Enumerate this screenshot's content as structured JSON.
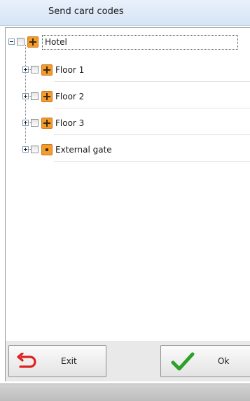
{
  "window": {
    "title": "Send card codes"
  },
  "tree": {
    "root": {
      "label": "Hotel",
      "icon": "floor-grid-icon"
    },
    "children": [
      {
        "label": "Floor 1",
        "icon": "floor-grid-icon"
      },
      {
        "label": "Floor 2",
        "icon": "floor-grid-icon"
      },
      {
        "label": "Floor 3",
        "icon": "floor-grid-icon"
      },
      {
        "label": "External gate",
        "icon": "gate-icon"
      }
    ]
  },
  "buttons": {
    "exit_label": "Exit",
    "ok_label": "Ok"
  },
  "colors": {
    "accent_orange": "#f39c2b",
    "exit_red": "#e02020",
    "ok_green": "#2aa12a"
  }
}
